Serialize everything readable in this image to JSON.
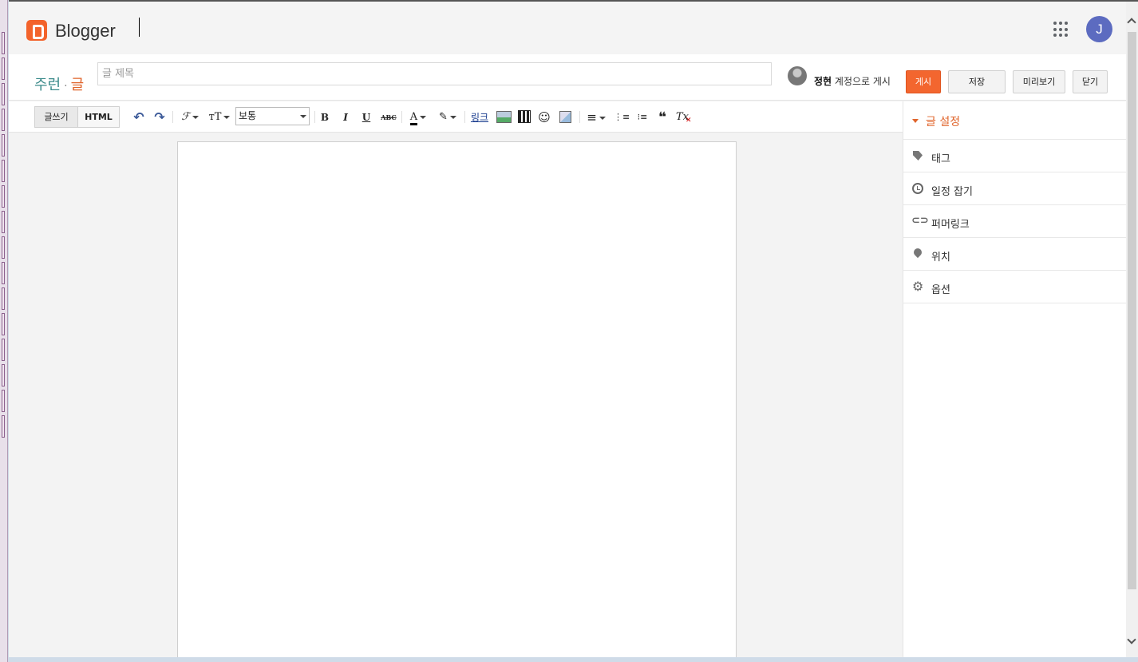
{
  "header": {
    "brand": "Blogger",
    "avatar_initial": "J"
  },
  "title_row": {
    "crumb_blog": "주런",
    "crumb_sep": "·",
    "crumb_post": "글",
    "title_placeholder": "글 제목",
    "author_name": "정현",
    "posting_as_suffix": " 계정으로 게시",
    "publish_label": "게시",
    "save_label": "저장",
    "preview_label": "미리보기",
    "close_label": "닫기"
  },
  "toolbar": {
    "compose_label": "글쓰기",
    "html_label": "HTML",
    "undo": "↶",
    "redo": "↷",
    "font_glyph": "ℱ",
    "font_size_glyph": "тT",
    "format_value": "보통",
    "bold": "B",
    "italic": "I",
    "underline": "U",
    "strike": "ABC",
    "text_color_glyph": "A",
    "highlight_glyph": "✎",
    "link_label": "링크",
    "emoji": "☺",
    "align_glyph": "≡",
    "numbered_list": "⋮≡",
    "bullet_list": "⁝≡",
    "quote": "❝",
    "clear_format": "Tx"
  },
  "sidebar": {
    "heading": "글 설정",
    "items": [
      {
        "label": "태그",
        "icon": "tag-icon"
      },
      {
        "label": "일정 잡기",
        "icon": "clock-icon"
      },
      {
        "label": "퍼머링크",
        "icon": "link-icon"
      },
      {
        "label": "위치",
        "icon": "pin-icon"
      },
      {
        "label": "옵션",
        "icon": "gear-icon"
      }
    ]
  },
  "colors": {
    "accent": "#f3662f",
    "blog_link": "#3a8a8a",
    "avatar": "#5c6bc0"
  }
}
